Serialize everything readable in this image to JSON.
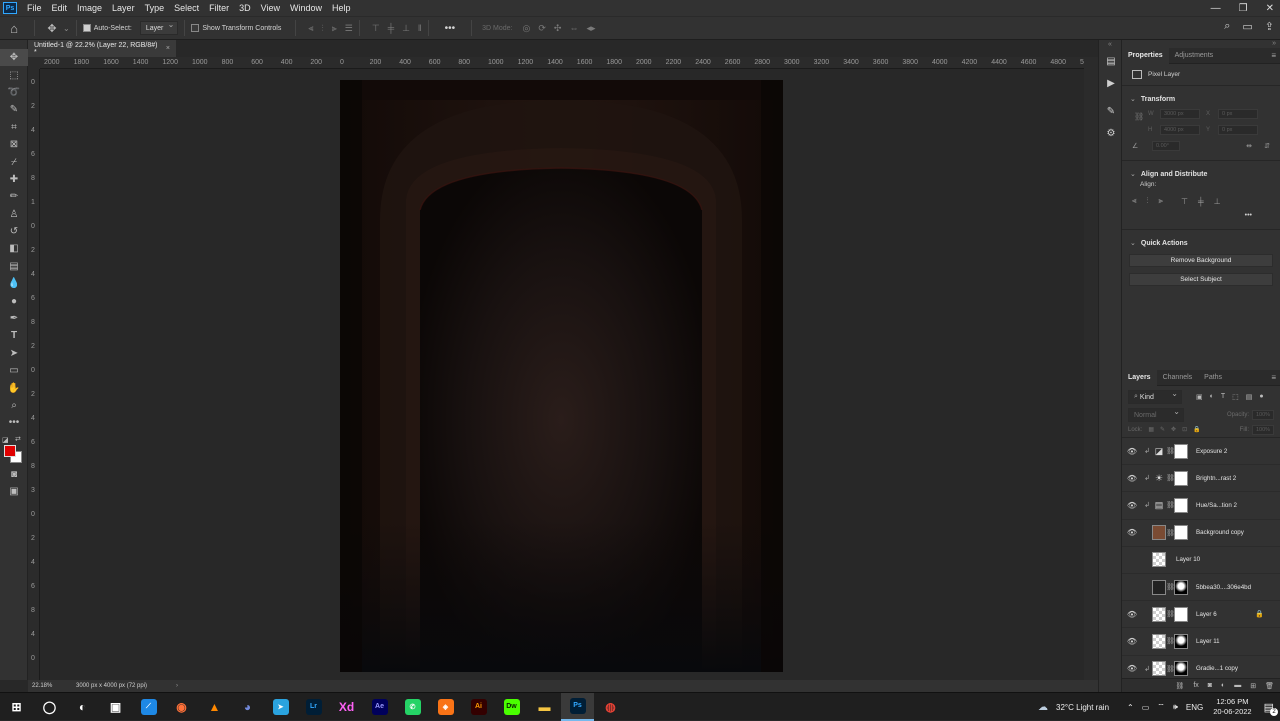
{
  "menubar": {
    "app_icon": "Ps",
    "items": [
      "File",
      "Edit",
      "Image",
      "Layer",
      "Type",
      "Select",
      "Filter",
      "3D",
      "View",
      "Window",
      "Help"
    ],
    "window_controls": [
      "minimize-icon",
      "restore-icon",
      "close-icon"
    ]
  },
  "options_bar": {
    "auto_select_label": "Auto-Select:",
    "auto_select_checked": true,
    "auto_select_target": "Layer",
    "transform_controls_label": "Show Transform Controls",
    "transform_controls_checked": false,
    "three_d_mode_label": "3D Mode:",
    "more_label": "•••"
  },
  "document": {
    "tab_title": "Untitled-1 @ 22.2% (Layer 22, RGB/8#) *",
    "close_label": "×"
  },
  "ruler_h_labels": [
    "2000",
    "1800",
    "1600",
    "1400",
    "1200",
    "1000",
    "800",
    "600",
    "400",
    "200",
    "0",
    "200",
    "400",
    "600",
    "800",
    "1000",
    "1200",
    "1400",
    "1600",
    "1800",
    "2000",
    "2200",
    "2400",
    "2600",
    "2800",
    "3000",
    "3200",
    "3400",
    "3600",
    "3800",
    "4000",
    "4200",
    "4400",
    "4600",
    "4800",
    "5"
  ],
  "ruler_v_labels": [
    "0",
    "2",
    "4",
    "6",
    "8",
    "1",
    "0",
    "2",
    "4",
    "6",
    "8",
    "2",
    "0",
    "2",
    "4",
    "6",
    "8",
    "3",
    "0",
    "2",
    "4",
    "6",
    "8",
    "4",
    "0"
  ],
  "status": {
    "zoom": "22.18%",
    "doc_info": "3000 px x 4000 px (72 ppi)",
    "arrow": "›"
  },
  "properties": {
    "tabs": [
      "Properties",
      "Adjustments"
    ],
    "layer_type": "Pixel Layer",
    "transform_title": "Transform",
    "w_label": "W",
    "w_value": "3000 px",
    "h_label": "H",
    "h_value": "4000 px",
    "x_label": "X",
    "x_value": "0 px",
    "y_label": "Y",
    "y_value": "0 px",
    "angle_value": "0.00°",
    "align_title": "Align and Distribute",
    "align_label": "Align:",
    "quick_actions_title": "Quick Actions",
    "remove_bg_label": "Remove Background",
    "select_subject_label": "Select Subject",
    "more_label": "•••"
  },
  "layers_panel": {
    "tabs": [
      "Layers",
      "Channels",
      "Paths"
    ],
    "filter_label": "Kind",
    "blend_mode": "Normal",
    "opacity_label": "Opacity:",
    "opacity_value": "100%",
    "lock_label": "Lock:",
    "fill_label": "Fill:",
    "fill_value": "100%",
    "layers": [
      {
        "name": "Exposure 2",
        "visible": true,
        "kind": "adjustment",
        "icon": "exposure-icon",
        "clipped": true
      },
      {
        "name": "Brightn...rast 2",
        "visible": true,
        "kind": "adjustment",
        "icon": "brightness-icon",
        "clipped": true
      },
      {
        "name": "Hue/Sa...tion 2",
        "visible": true,
        "kind": "adjustment",
        "icon": "hue-saturation-icon",
        "clipped": true
      },
      {
        "name": "Background copy",
        "visible": true,
        "kind": "pixel-mask",
        "icon": "",
        "clipped": false
      },
      {
        "name": "Layer 10",
        "visible": false,
        "kind": "empty",
        "icon": "",
        "clipped": false
      },
      {
        "name": "5bbea30....306e4bd",
        "visible": false,
        "kind": "image-mask",
        "icon": "",
        "clipped": false
      },
      {
        "name": "Layer 6",
        "visible": true,
        "kind": "pixel-mask",
        "icon": "",
        "clipped": false,
        "locked": true
      },
      {
        "name": "Layer 11",
        "visible": true,
        "kind": "pixel-darkmask",
        "icon": "",
        "clipped": false
      },
      {
        "name": "Gradie...1 copy",
        "visible": true,
        "kind": "gradient",
        "icon": "",
        "clipped": true
      }
    ]
  },
  "taskbar": {
    "weather": "32°C  Light rain",
    "lang": "ENG",
    "time": "12:06 PM",
    "date": "20-06-2022",
    "apps": [
      {
        "name": "start",
        "label": "⊞",
        "color": "#ffffff",
        "bg": "transparent"
      },
      {
        "name": "cortana",
        "label": "◯",
        "color": "#ffffff",
        "bg": "transparent"
      },
      {
        "name": "app-1",
        "label": "◐",
        "color": "#ffffff",
        "bg": "transparent"
      },
      {
        "name": "app-2",
        "label": "▣",
        "color": "#ffffff",
        "bg": "transparent"
      },
      {
        "name": "app-3",
        "label": "⟋",
        "color": "#ffffff",
        "bg": "#1e88e5"
      },
      {
        "name": "firefox",
        "label": "◉",
        "color": "#ff7139",
        "bg": "transparent"
      },
      {
        "name": "vlc",
        "label": "▲",
        "color": "#ff8800",
        "bg": "transparent"
      },
      {
        "name": "discord",
        "label": "◕",
        "color": "#7289da",
        "bg": "transparent"
      },
      {
        "name": "telegram",
        "label": "➤",
        "color": "#ffffff",
        "bg": "#2aa3df"
      },
      {
        "name": "lightroom",
        "label": "Lr",
        "color": "#31a8ff",
        "bg": "#001e36"
      },
      {
        "name": "xd",
        "label": "Xd",
        "color": "#ff61f6",
        "bg": "transparent"
      },
      {
        "name": "after-effects",
        "label": "Ae",
        "color": "#9999ff",
        "bg": "#00005b"
      },
      {
        "name": "whatsapp",
        "label": "✆",
        "color": "#ffffff",
        "bg": "#25d366"
      },
      {
        "name": "app-4",
        "label": "◈",
        "color": "#ffffff",
        "bg": "#f97316"
      },
      {
        "name": "illustrator",
        "label": "Ai",
        "color": "#ff9a00",
        "bg": "#330000"
      },
      {
        "name": "dreamweaver",
        "label": "Dw",
        "color": "#072401",
        "bg": "#4afe00"
      },
      {
        "name": "explorer",
        "label": "▬",
        "color": "#f5c542",
        "bg": "transparent"
      },
      {
        "name": "photoshop",
        "label": "Ps",
        "color": "#31a8ff",
        "bg": "#001e36",
        "active": true
      },
      {
        "name": "chrome",
        "label": "◍",
        "color": "#e94235",
        "bg": "transparent"
      }
    ],
    "notification_badge": "2"
  },
  "colors": {
    "foreground": "#e00000",
    "background": "#ffffff",
    "accent": "#31a8ff"
  }
}
